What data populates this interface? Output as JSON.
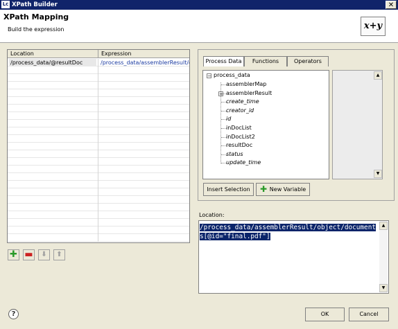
{
  "window": {
    "app_icon": "Lc",
    "title": "XPath Builder",
    "close_symbol": "✕"
  },
  "banner": {
    "title": "XPath Mapping",
    "subtitle": "Build the expression",
    "logo": "x+y"
  },
  "table": {
    "columns": [
      "Location",
      "Expression"
    ],
    "rows": [
      {
        "location": "/process_data/@resultDoc",
        "expression": "/process_data/assemblerResult/o"
      }
    ]
  },
  "tabs": [
    "Process Data",
    "Functions",
    "Operators"
  ],
  "tree": {
    "root": "process_data",
    "items": [
      {
        "label": "assemblerMap",
        "italic": false,
        "expandable": false
      },
      {
        "label": "assemblerResult",
        "italic": false,
        "expandable": true
      },
      {
        "label": "create_time",
        "italic": true,
        "expandable": false
      },
      {
        "label": "creator_id",
        "italic": true,
        "expandable": false
      },
      {
        "label": "id",
        "italic": true,
        "expandable": false
      },
      {
        "label": "inDocList",
        "italic": false,
        "expandable": false
      },
      {
        "label": "inDocList2",
        "italic": false,
        "expandable": false
      },
      {
        "label": "resultDoc",
        "italic": false,
        "expandable": false
      },
      {
        "label": "status",
        "italic": true,
        "expandable": false
      },
      {
        "label": "update_time",
        "italic": true,
        "expandable": false
      }
    ]
  },
  "buttons": {
    "insert_selection": "Insert Selection",
    "new_variable": "New Variable",
    "ok": "OK",
    "cancel": "Cancel"
  },
  "location": {
    "label": "Location:",
    "value": "/process_data/assemblerResult/object/documents[@id=\"final.pdf\"]"
  },
  "icons": {
    "add": "plus-icon",
    "remove": "minus-icon",
    "down": "arrow-down-icon",
    "up": "arrow-up-icon",
    "help": "help-icon"
  }
}
